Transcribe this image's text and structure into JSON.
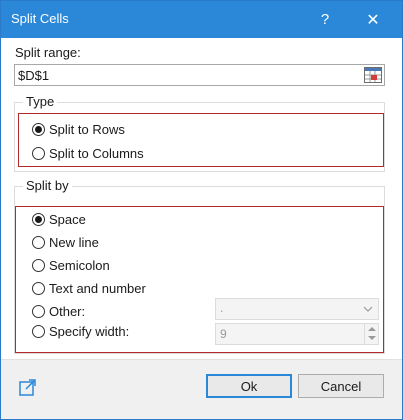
{
  "window": {
    "title": "Split Cells",
    "help_label": "?",
    "close_label": "✕",
    "accent_color": "#2b88d8"
  },
  "range": {
    "label": "Split range:",
    "value": "$D$1",
    "picker_icon": "range-select-icon"
  },
  "type_group": {
    "label": "Type",
    "options": [
      {
        "label": "Split to Rows",
        "checked": true
      },
      {
        "label": "Split to Columns",
        "checked": false
      }
    ]
  },
  "split_by_group": {
    "label": "Split by",
    "options": [
      {
        "label": "Space",
        "checked": true
      },
      {
        "label": "New line",
        "checked": false
      },
      {
        "label": "Semicolon",
        "checked": false
      },
      {
        "label": "Text and number",
        "checked": false
      },
      {
        "label": "Other:",
        "checked": false
      },
      {
        "label": "Specify width:",
        "checked": false
      }
    ],
    "other_value": ".",
    "width_value": "9"
  },
  "footer": {
    "link_icon": "external-link-icon",
    "ok_label": "Ok",
    "cancel_label": "Cancel"
  }
}
